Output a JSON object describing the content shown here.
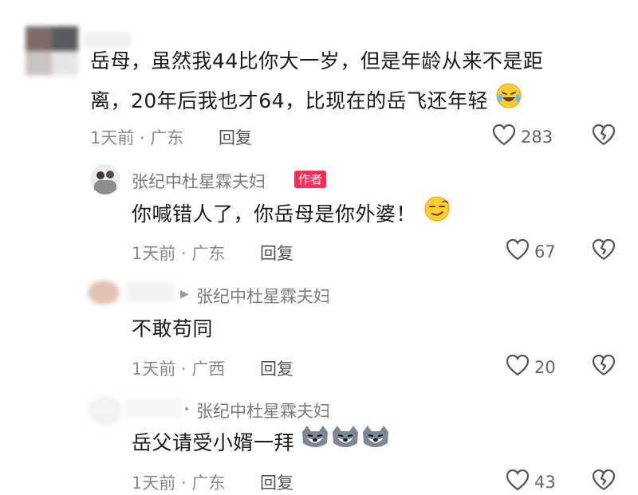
{
  "comment1": {
    "text_line1": "岳母，虽然我44比你大一岁，但是年龄从来不是距",
    "text_line2": "离，20年后我也才64，比现在的岳飞还年轻",
    "emoji_icon": "laughing-crying-emoji",
    "time_location": "1天前 · 广东",
    "reply_label": "回复",
    "like_count": "283"
  },
  "reply1": {
    "username": "张纪中杜星霖夫妇",
    "badge": "作者",
    "text": "你喊错人了，你岳母是你外婆！",
    "emoji_icon": "smirk-emoji",
    "time_location": "1天前 · 广东",
    "reply_label": "回复",
    "like_count": "67"
  },
  "reply2": {
    "reply_to": "张纪中杜星霖夫妇",
    "text": "不敢苟同",
    "time_location": "1天前 · 广西",
    "reply_label": "回复",
    "like_count": "20"
  },
  "reply3": {
    "reply_to": "张纪中杜星霖夫妇",
    "text": "岳父请受小婿一拜",
    "emoji_icon": "husky-dog-emoji",
    "time_location": "1天前 · 广东",
    "reply_label": "回复",
    "like_count": "43"
  },
  "colors": {
    "author_badge": "#fe2c55",
    "meta_text": "#8a8a8a"
  }
}
